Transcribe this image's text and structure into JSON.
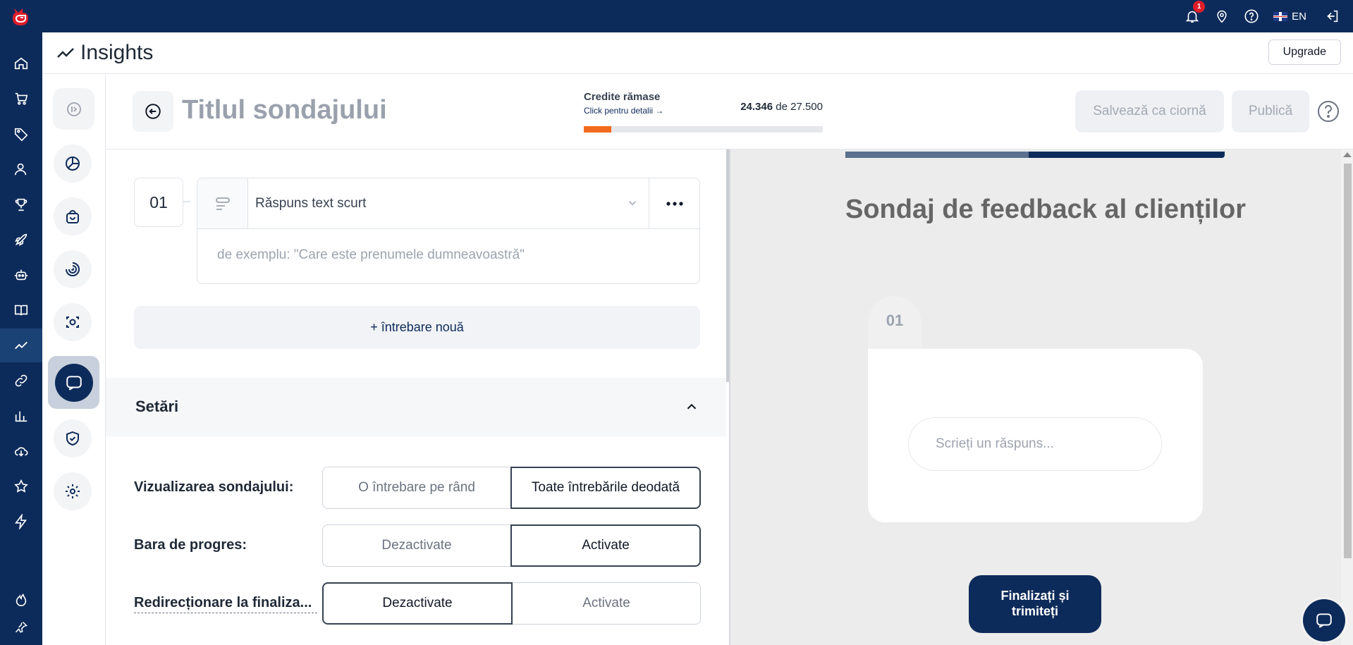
{
  "topbar": {
    "notifications_count": "1",
    "language": "EN"
  },
  "header": {
    "title": "Insights",
    "upgrade_label": "Upgrade"
  },
  "survey": {
    "title": "Titlul sondajului",
    "credits_label": "Credite rămase",
    "credits_link": "Click pentru detalii →",
    "credits_used": "24.346",
    "credits_of": "de",
    "credits_total": "27.500",
    "credits_fill_fraction": 0.115,
    "save_draft_label": "Salvează ca ciornă",
    "publish_label": "Publică"
  },
  "question": {
    "number": "01",
    "type": "Răspuns text scurt",
    "placeholder": "de exemplu: \"Care este prenumele dumneavoastră\""
  },
  "new_question_label": "+ întrebare nouă",
  "settings": {
    "title": "Setări",
    "rows": [
      {
        "label": "Vizualizarea sondajului:",
        "left": "O întrebare pe rând",
        "right": "Toate întrebările deodată",
        "selected": "right"
      },
      {
        "label": "Bara de progres:",
        "left": "Dezactivate",
        "right": "Activate",
        "selected": "right"
      },
      {
        "label": "Redirecționare la finaliza...",
        "left": "Dezactivate",
        "right": "Activate",
        "selected": "left"
      }
    ]
  },
  "preview": {
    "title": "Sondaj de feedback al clienților",
    "question_number": "01",
    "answer_placeholder": "Scrieți un răspuns...",
    "submit_label": "Finalizați și trimiteți"
  },
  "icons": {
    "accent": "#0d2b5a",
    "progress": "#f26b1d",
    "badge": "#e11d2a"
  }
}
